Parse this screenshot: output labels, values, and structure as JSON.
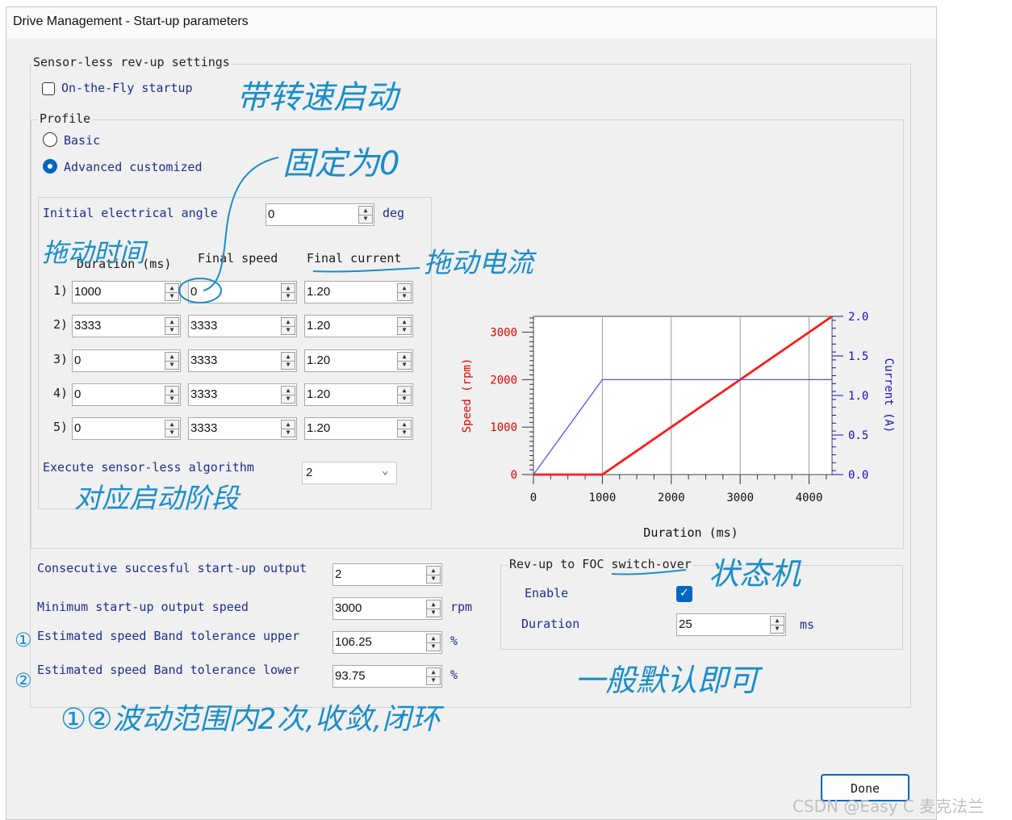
{
  "window": {
    "title": "Drive Management - Start-up parameters"
  },
  "sensorless": {
    "group_title": "Sensor-less rev-up settings",
    "on_the_fly_label": "On-the-Fly startup",
    "on_the_fly_checked": false,
    "profile": {
      "title": "Profile",
      "options": [
        {
          "label": "Basic",
          "selected": false
        },
        {
          "label": "Advanced customized",
          "selected": true
        }
      ]
    },
    "initial_angle": {
      "label": "Initial electrical angle",
      "value": "0",
      "unit": "deg"
    },
    "table": {
      "headers": [
        "Duration (ms)",
        "Final speed",
        "Final current"
      ],
      "rows": [
        {
          "index": "1)",
          "duration": "1000",
          "speed": "0",
          "current": "1.20"
        },
        {
          "index": "2)",
          "duration": "3333",
          "speed": "3333",
          "current": "1.20"
        },
        {
          "index": "3)",
          "duration": "0",
          "speed": "3333",
          "current": "1.20"
        },
        {
          "index": "4)",
          "duration": "0",
          "speed": "3333",
          "current": "1.20"
        },
        {
          "index": "5)",
          "duration": "0",
          "speed": "3333",
          "current": "1.20"
        }
      ]
    },
    "execute": {
      "label": "Execute sensor-less algorithm",
      "value": "2"
    }
  },
  "chart_data": {
    "type": "line",
    "xlabel": "Duration (ms)",
    "ylabel": "Speed (rpm)",
    "y2label": "Current (A)",
    "xlim": [
      0,
      4333
    ],
    "ylim": [
      0,
      3333
    ],
    "y2lim": [
      0,
      2.0
    ],
    "x_ticks": [
      "0",
      "1000",
      "2000",
      "3000",
      "4000"
    ],
    "y_ticks": [
      "0",
      "1000",
      "2000",
      "3000"
    ],
    "y2_ticks": [
      "0.0",
      "0.5",
      "1.0",
      "1.5",
      "2.0"
    ],
    "series": [
      {
        "axis": "left",
        "color": "#ff1a1a",
        "x": [
          0,
          1000,
          4333
        ],
        "values": [
          0,
          0,
          3333
        ]
      },
      {
        "axis": "right",
        "color": "#5050ff",
        "x": [
          0,
          1000,
          4333
        ],
        "values": [
          0,
          1.2,
          1.2
        ]
      }
    ],
    "vgrid": [
      1000,
      2000,
      3000,
      4000
    ],
    "colors": {
      "speed_axis": "#e00000",
      "current_axis": "#1010d0"
    }
  },
  "output": {
    "consecutive": {
      "label": "Consecutive succesful start-up output",
      "value": "2"
    },
    "min_speed": {
      "label": "Minimum start-up output speed",
      "value": "3000",
      "unit": "rpm"
    },
    "band_upper": {
      "label": "Estimated speed Band tolerance upper",
      "value": "106.25",
      "unit": "%"
    },
    "band_lower": {
      "label": "Estimated speed Band tolerance lower",
      "value": "93.75",
      "unit": "%"
    }
  },
  "foc": {
    "title": "Rev-up to FOC switch-over",
    "enable_label": "Enable",
    "enable_checked": true,
    "duration_label": "Duration",
    "duration_value": "25",
    "duration_unit": "ms"
  },
  "done_label": "Done",
  "annotations": {
    "on_the_fly": "带转速启动",
    "fixed_zero": "固定为0",
    "drag_time": "拖动时间",
    "drag_current": "拖动电流",
    "stage": "对应启动阶段",
    "state_machine": "状态机",
    "default_ok": "一般默认即可",
    "circle1": "①",
    "circle2": "②",
    "bottom": "①②波动范围内2次,收敛,闭环"
  },
  "watermark": "CSDN @Easy C 麦克法兰"
}
